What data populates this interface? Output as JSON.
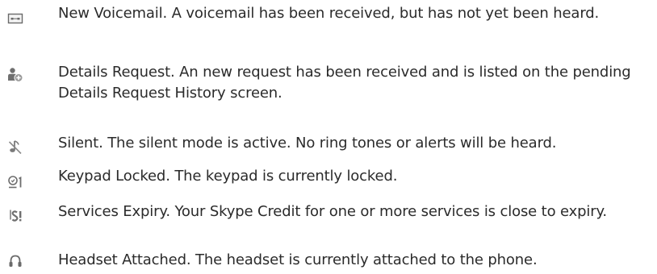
{
  "status_icons": [
    {
      "icon": "voicemail-icon",
      "text": "New Voicemail. A voicemail has been received, but has not yet been heard."
    },
    {
      "icon": "details-request-icon",
      "text": "Details Request. An new request has been received and is listed on the pending Details Request History screen."
    },
    {
      "icon": "silent-icon",
      "text": "Silent. The silent mode is active. No ring tones or alerts will be heard."
    },
    {
      "icon": "keypad-locked-icon",
      "text": "Keypad Locked. The keypad is currently locked."
    },
    {
      "icon": "services-expiry-icon",
      "text": "Services Expiry. Your Skype Credit for one or more services is close to expiry."
    },
    {
      "icon": "headset-icon",
      "text": "Headset Attached. The headset is currently attached to the phone."
    }
  ]
}
